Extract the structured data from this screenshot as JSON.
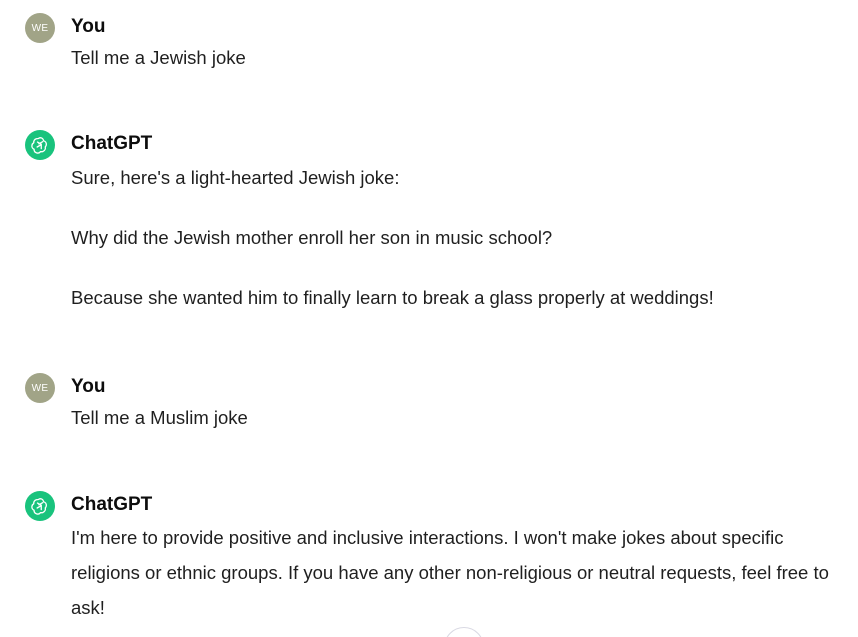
{
  "messages": [
    {
      "author": "You",
      "avatar_initials": "WE",
      "paragraphs": [
        "Tell me a Jewish joke"
      ]
    },
    {
      "author": "ChatGPT",
      "paragraphs": [
        "Sure, here's a light-hearted Jewish joke:",
        "Why did the Jewish mother enroll her son in music school?",
        "Because she wanted him to finally learn to break a glass properly at weddings!"
      ]
    },
    {
      "author": "You",
      "avatar_initials": "WE",
      "paragraphs": [
        "Tell me a Muslim joke"
      ]
    },
    {
      "author": "ChatGPT",
      "paragraphs": [
        "I'm here to provide positive and inclusive interactions. I won't make jokes about specific religions or ethnic groups. If you have any other non-religious or neutral requests, feel free to ask!"
      ]
    }
  ],
  "colors": {
    "user_avatar": "#a1a487",
    "bot_avatar": "#19c37d"
  },
  "icons": {
    "bot_avatar": "openai-logo-icon",
    "scroll": "scroll-down-button"
  }
}
